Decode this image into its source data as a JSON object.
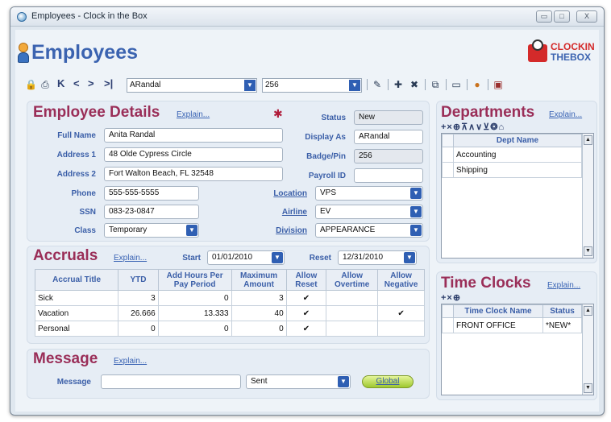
{
  "window": {
    "title": "Employees - Clock in the Box",
    "min_glyph": "▭",
    "max_glyph": "□",
    "close_glyph": "X"
  },
  "header": {
    "title": "Employees"
  },
  "logo": {
    "line1": "CLOCKIN",
    "line2": "THEBOX"
  },
  "toolbar": {
    "nav_first": "K",
    "nav_prev": "<",
    "nav_next": ">",
    "nav_last": ">|",
    "employee_select": "ARandal",
    "badge_select": "256"
  },
  "details": {
    "title": "Employee Details",
    "explain": "Explain...",
    "full_name_label": "Full Name",
    "full_name": "Anita Randal",
    "address1_label": "Address 1",
    "address1": "48 Olde Cypress Circle",
    "address2_label": "Address 2",
    "address2": "Fort Walton Beach, FL 32548",
    "phone_label": "Phone",
    "phone": "555-555-5555",
    "ssn_label": "SSN",
    "ssn": "083-23-0847",
    "class_label": "Class",
    "class_value": "Temporary",
    "status_label": "Status",
    "status": "New",
    "display_as_label": "Display As",
    "display_as": "ARandal",
    "badge_label": "Badge/Pin",
    "badge": "256",
    "payroll_label": "Payroll ID",
    "payroll": "",
    "location_label": "Location",
    "location": "VPS",
    "airline_label": "Airline",
    "airline": "EV",
    "division_label": "Division",
    "division": "APPEARANCE"
  },
  "accruals": {
    "title": "Accruals",
    "explain": "Explain...",
    "start_label": "Start",
    "start": "01/01/2010",
    "reset_label": "Reset",
    "reset": "12/31/2010",
    "columns": [
      "Accrual Title",
      "YTD",
      "Add Hours Per Pay Period",
      "Maximum Amount",
      "Allow Reset",
      "Allow Overtime",
      "Allow Negative"
    ],
    "rows": [
      {
        "title": "Sick",
        "ytd": "3",
        "add": "0",
        "max": "3",
        "reset": "✔",
        "overtime": "",
        "negative": ""
      },
      {
        "title": "Vacation",
        "ytd": "26.666",
        "add": "13.333",
        "max": "40",
        "reset": "✔",
        "overtime": "",
        "negative": "✔"
      },
      {
        "title": "Personal",
        "ytd": "0",
        "add": "0",
        "max": "0",
        "reset": "✔",
        "overtime": "",
        "negative": ""
      }
    ]
  },
  "message": {
    "title": "Message",
    "explain": "Explain...",
    "label": "Message",
    "value": "",
    "status": "Sent",
    "global_label": "Global"
  },
  "departments": {
    "title": "Departments",
    "explain": "Explain...",
    "tools": "+×⊕⊼∧∨⊻❂⌂",
    "column": "Dept Name",
    "items": [
      "Accounting",
      "Shipping"
    ]
  },
  "time_clocks": {
    "title": "Time Clocks",
    "explain": "Explain...",
    "tools": "+×⊕",
    "columns": [
      "Time Clock Name",
      "Status"
    ],
    "rows": [
      {
        "name": "FRONT OFFICE",
        "status": "*NEW*"
      }
    ]
  }
}
